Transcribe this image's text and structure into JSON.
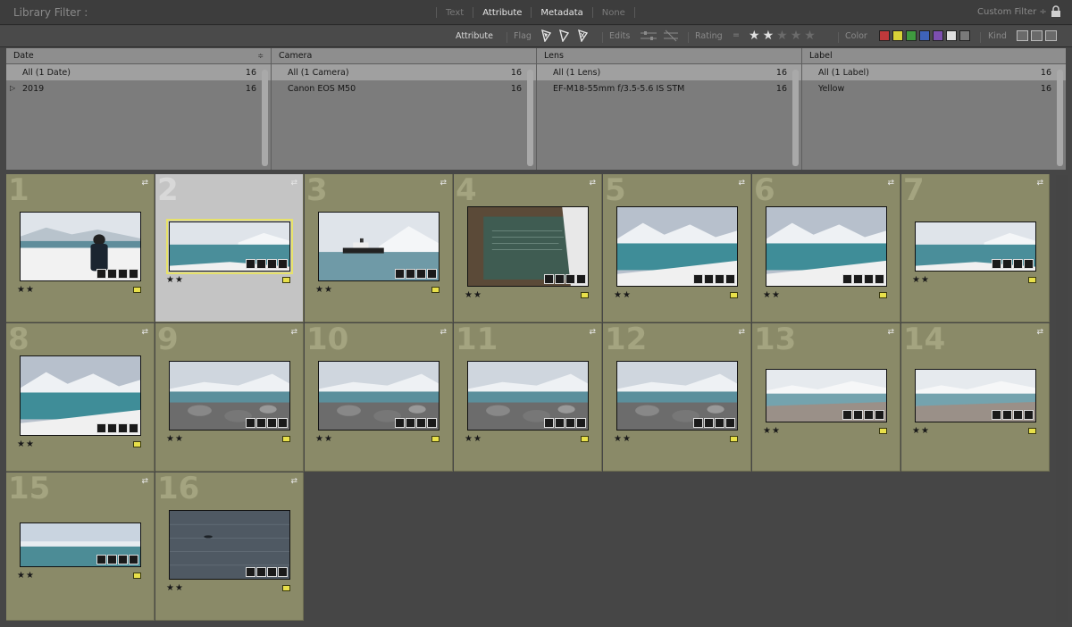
{
  "topbar": {
    "title": "Library Filter :",
    "modes": [
      "Text",
      "Attribute",
      "Metadata",
      "None"
    ],
    "active_mode": "Attribute",
    "custom_filter": "Custom Filter ÷"
  },
  "attr": {
    "attribute": "Attribute",
    "flag": "Flag",
    "edits": "Edits",
    "rating": "Rating",
    "rating_op": "=",
    "rating_value": 2,
    "color": "Color",
    "kind": "Kind",
    "colors": [
      "#c0393b",
      "#d8d238",
      "#3f9a3f",
      "#3e63b8",
      "#7d4fb0",
      "#dedede",
      "#7a7a7a"
    ]
  },
  "columns": [
    {
      "header": "Date",
      "rows": [
        {
          "label": "All (1 Date)",
          "count": "16"
        },
        {
          "label": "2019",
          "count": "16"
        }
      ]
    },
    {
      "header": "Camera",
      "rows": [
        {
          "label": "All (1 Camera)",
          "count": "16"
        },
        {
          "label": "Canon EOS M50",
          "count": "16"
        }
      ]
    },
    {
      "header": "Lens",
      "rows": [
        {
          "label": "All (1 Lens)",
          "count": "16"
        },
        {
          "label": "EF-M18-55mm f/3.5-5.6 IS STM",
          "count": "16"
        }
      ]
    },
    {
      "header": "Label",
      "rows": [
        {
          "label": "All (1 Label)",
          "count": "16"
        },
        {
          "label": "Yellow",
          "count": "16"
        }
      ]
    }
  ],
  "photos": [
    {
      "num": "1",
      "stars": "★★",
      "scene": "person"
    },
    {
      "num": "2",
      "stars": "★★",
      "scene": "sea"
    },
    {
      "num": "3",
      "stars": "★★",
      "scene": "ship"
    },
    {
      "num": "4",
      "stars": "★★",
      "scene": "plaque"
    },
    {
      "num": "5",
      "stars": "★★",
      "scene": "mountain"
    },
    {
      "num": "6",
      "stars": "★★",
      "scene": "mountain"
    },
    {
      "num": "7",
      "stars": "★★",
      "scene": "sea"
    },
    {
      "num": "8",
      "stars": "★★",
      "scene": "mountain"
    },
    {
      "num": "9",
      "stars": "★★",
      "scene": "rocks"
    },
    {
      "num": "10",
      "stars": "★★",
      "scene": "rocks"
    },
    {
      "num": "11",
      "stars": "★★",
      "scene": "rocks"
    },
    {
      "num": "12",
      "stars": "★★",
      "scene": "rocks"
    },
    {
      "num": "13",
      "stars": "★★",
      "scene": "beach"
    },
    {
      "num": "14",
      "stars": "★★",
      "scene": "beach"
    },
    {
      "num": "15",
      "stars": "★★",
      "scene": "glacier"
    },
    {
      "num": "16",
      "stars": "★★",
      "scene": "water"
    }
  ],
  "selected_photo": "2",
  "colors": {
    "cell_bg": "#8a8a68",
    "label_yellow": "#e8e04a",
    "selected_bg": "#c4c4c4"
  }
}
